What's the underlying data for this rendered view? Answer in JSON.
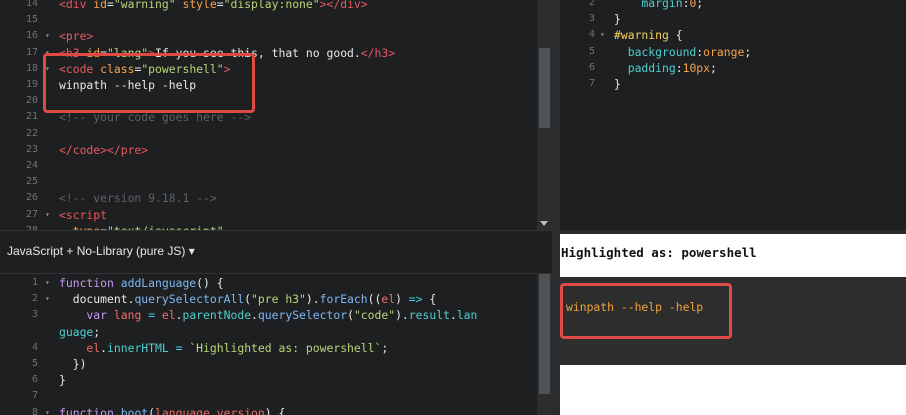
{
  "html_editor": {
    "lines": [
      {
        "n": "14",
        "parts": [
          [
            "tag",
            "<div "
          ],
          [
            "attr",
            "id"
          ],
          [
            "plain",
            "="
          ],
          [
            "str",
            "\"warning\""
          ],
          [
            "plain",
            " "
          ],
          [
            "attr",
            "style"
          ],
          [
            "plain",
            "="
          ],
          [
            "str",
            "\"display:none\""
          ],
          [
            "tag",
            "></div>"
          ]
        ]
      },
      {
        "n": "15",
        "parts": []
      },
      {
        "n": "16",
        "fold": true,
        "parts": [
          [
            "tag",
            "<pre>"
          ]
        ]
      },
      {
        "n": "17",
        "fold": true,
        "parts": [
          [
            "tag",
            "<h3 "
          ],
          [
            "attr",
            "id"
          ],
          [
            "plain",
            "="
          ],
          [
            "str",
            "\"lang\""
          ],
          [
            "tag",
            ">"
          ],
          [
            "plain",
            "If you see this, that no good."
          ],
          [
            "tag",
            "</h3>"
          ]
        ]
      },
      {
        "n": "18",
        "fold": true,
        "parts": [
          [
            "tag",
            "<code "
          ],
          [
            "attr",
            "class"
          ],
          [
            "plain",
            "="
          ],
          [
            "str",
            "\"powershell\""
          ],
          [
            "tag",
            ">"
          ]
        ]
      },
      {
        "n": "19",
        "parts": [
          [
            "plain",
            "winpath --help -help"
          ]
        ]
      },
      {
        "n": "20",
        "parts": []
      },
      {
        "n": "21",
        "parts": [
          [
            "cmt",
            "<!-- your code goes here -->"
          ]
        ]
      },
      {
        "n": "22",
        "parts": []
      },
      {
        "n": "23",
        "parts": [
          [
            "tag",
            "</code></pre>"
          ]
        ]
      },
      {
        "n": "24",
        "parts": []
      },
      {
        "n": "25",
        "parts": []
      },
      {
        "n": "26",
        "parts": [
          [
            "cmt",
            "<!-- version 9.18.1 -->"
          ]
        ]
      },
      {
        "n": "27",
        "fold": true,
        "parts": [
          [
            "tag",
            "<script"
          ]
        ]
      },
      {
        "n": "28",
        "parts": [
          [
            "attr",
            "  type"
          ],
          [
            "plain",
            "="
          ],
          [
            "str",
            "\"text/javascript\""
          ]
        ]
      }
    ]
  },
  "css_editor": {
    "lines": [
      {
        "n": "2",
        "parts": [
          [
            "prop",
            "    margin"
          ],
          [
            "plain",
            ":"
          ],
          [
            "num",
            "0"
          ],
          [
            "plain",
            ";"
          ]
        ]
      },
      {
        "n": "3",
        "parts": [
          [
            "plain",
            "}"
          ]
        ]
      },
      {
        "n": "4",
        "fold": true,
        "parts": [
          [
            "cls",
            "#warning"
          ],
          [
            "plain",
            " {"
          ]
        ]
      },
      {
        "n": "5",
        "parts": [
          [
            "prop",
            "  background"
          ],
          [
            "plain",
            ":"
          ],
          [
            "num",
            "orange"
          ],
          [
            "plain",
            ";"
          ]
        ]
      },
      {
        "n": "6",
        "parts": [
          [
            "prop",
            "  padding"
          ],
          [
            "plain",
            ":"
          ],
          [
            "num",
            "10px"
          ],
          [
            "plain",
            ";"
          ]
        ]
      },
      {
        "n": "7",
        "parts": [
          [
            "plain",
            "}"
          ]
        ]
      }
    ]
  },
  "js_toolbar": {
    "label": "JavaScript + No-Library (pure JS) ▾"
  },
  "js_editor": {
    "lines": [
      {
        "n": "1",
        "fold": true,
        "parts": [
          [
            "kw",
            "function "
          ],
          [
            "fn",
            "addLanguage"
          ],
          [
            "plain",
            "() {"
          ]
        ]
      },
      {
        "n": "2",
        "fold": true,
        "parts": [
          [
            "plain",
            "  document."
          ],
          [
            "fn",
            "querySelectorAll"
          ],
          [
            "plain",
            "("
          ],
          [
            "str",
            "\"pre h3\""
          ],
          [
            "plain",
            ")."
          ],
          [
            "fn",
            "forEach"
          ],
          [
            "plain",
            "(("
          ],
          [
            "var",
            "el"
          ],
          [
            "plain",
            ") "
          ],
          [
            "op",
            "=>"
          ],
          [
            "plain",
            " {"
          ]
        ]
      },
      {
        "n": "3",
        "parts": [
          [
            "kw",
            "    var "
          ],
          [
            "var",
            "lang"
          ],
          [
            "op",
            " = "
          ],
          [
            "var",
            "el"
          ],
          [
            "plain",
            "."
          ],
          [
            "prop",
            "parentNode"
          ],
          [
            "plain",
            "."
          ],
          [
            "fn",
            "querySelector"
          ],
          [
            "plain",
            "("
          ],
          [
            "str",
            "\"code\""
          ],
          [
            "plain",
            ")."
          ],
          [
            "prop",
            "result"
          ],
          [
            "plain",
            "."
          ],
          [
            "prop",
            "lan"
          ]
        ]
      },
      {
        "n": "",
        "parts": [
          [
            "prop",
            "guage"
          ],
          [
            "plain",
            ";"
          ]
        ]
      },
      {
        "n": "4",
        "parts": [
          [
            "var",
            "    el"
          ],
          [
            "plain",
            "."
          ],
          [
            "prop",
            "innerHTML"
          ],
          [
            "op",
            " = "
          ],
          [
            "str",
            "`Highlighted as: powershell`"
          ],
          [
            "plain",
            ";"
          ]
        ]
      },
      {
        "n": "5",
        "parts": [
          [
            "plain",
            "  })"
          ]
        ]
      },
      {
        "n": "6",
        "parts": [
          [
            "plain",
            "}"
          ]
        ]
      },
      {
        "n": "7",
        "parts": []
      },
      {
        "n": "8",
        "fold": true,
        "parts": [
          [
            "kw",
            "function "
          ],
          [
            "fn",
            "boot"
          ],
          [
            "plain",
            "("
          ],
          [
            "var",
            "language"
          ],
          [
            "plain",
            ","
          ],
          [
            "var",
            "version"
          ],
          [
            "plain",
            ") {"
          ]
        ]
      }
    ]
  },
  "result": {
    "title": "Highlighted as: powershell",
    "code": "winpath --help -help"
  },
  "colors": {
    "highlight_box": "#e04a44",
    "editor_bg": "#1d1f21"
  }
}
